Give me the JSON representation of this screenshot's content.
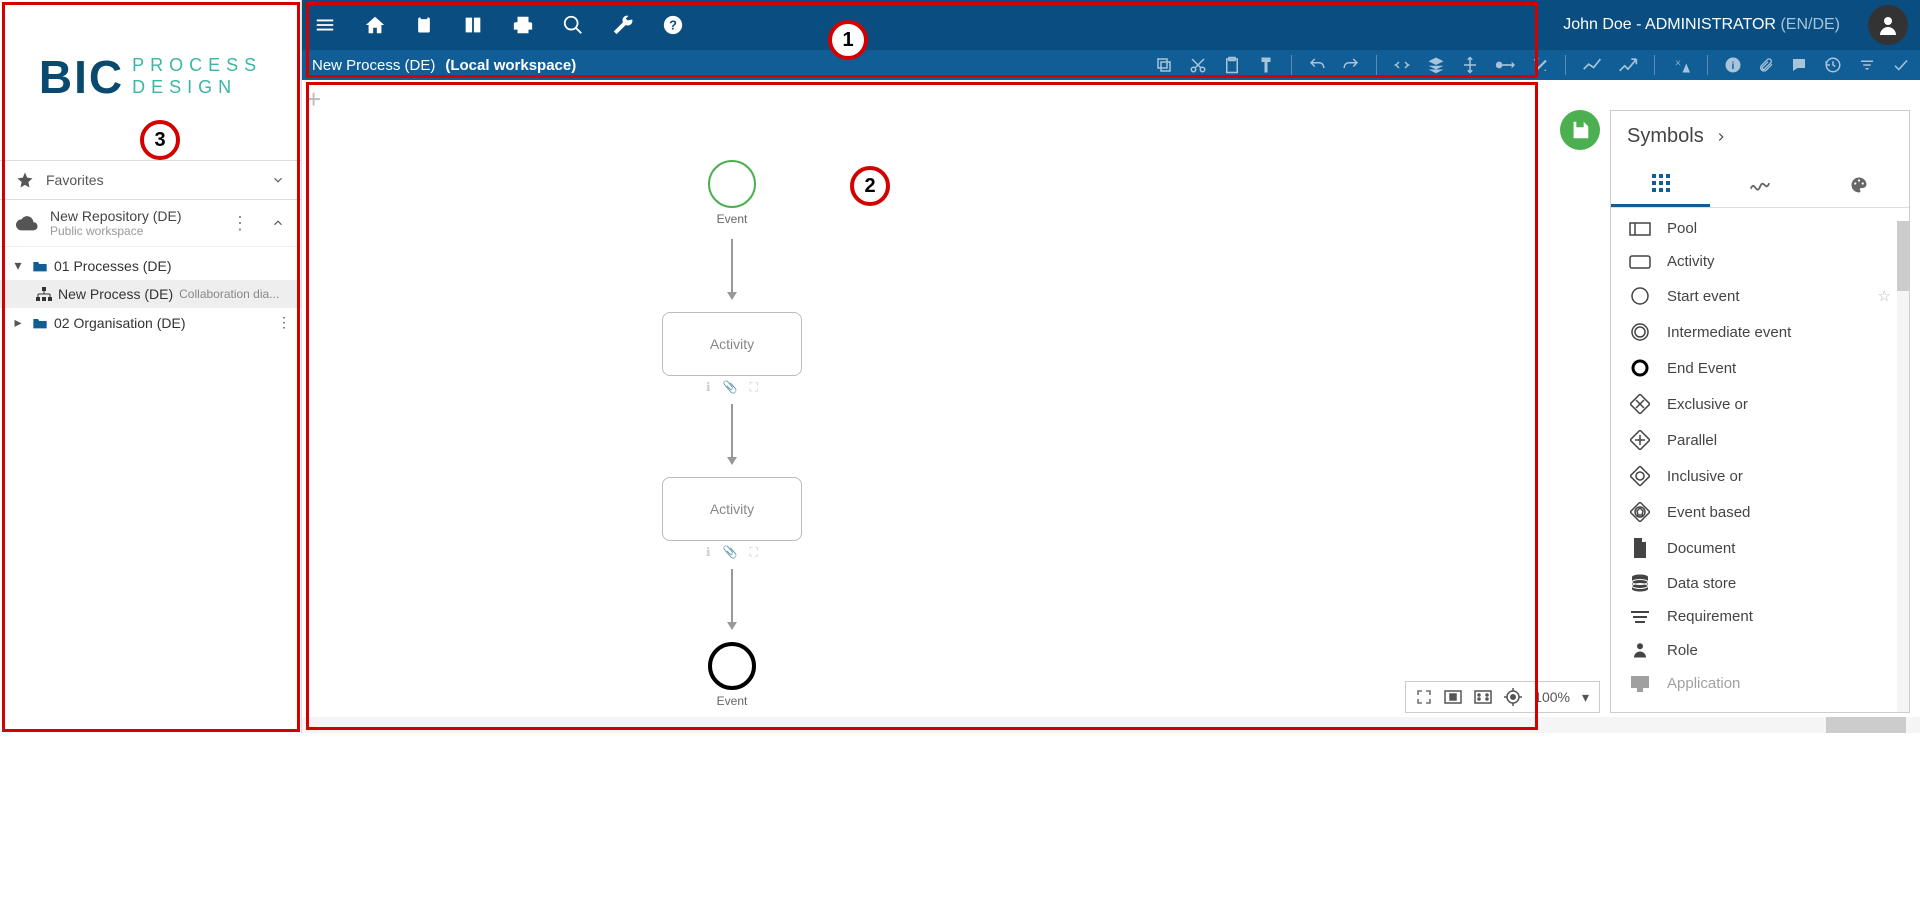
{
  "header": {
    "user": "John Doe - ADMINISTRATOR",
    "lang": "(EN/DE)"
  },
  "toolbar2": {
    "process_name": "New Process (DE)",
    "workspace": "(Local workspace)"
  },
  "sidebar": {
    "logo_main": "BIC",
    "logo_line1": "PROCESS",
    "logo_line2": "DESIGN",
    "favorites": "Favorites",
    "repo_name": "New Repository (DE)",
    "repo_sub": "Public workspace",
    "tree": {
      "processes": "01 Processes (DE)",
      "new_process": "New Process (DE)",
      "new_process_type": "Collaboration dia...",
      "organisation": "02 Organisation (DE)"
    }
  },
  "diagram": {
    "event_top": "Event",
    "activity1": "Activity",
    "activity2": "Activity",
    "event_bottom": "Event"
  },
  "symbols": {
    "title": "Symbols",
    "items": [
      "Pool",
      "Activity",
      "Start event",
      "Intermediate event",
      "End Event",
      "Exclusive or",
      "Parallel",
      "Inclusive or",
      "Event based",
      "Document",
      "Data store",
      "Requirement",
      "Role",
      "Application"
    ]
  },
  "zoom": {
    "value": "100%"
  },
  "annotations": {
    "c1": "1",
    "c2": "2",
    "c3": "3"
  }
}
